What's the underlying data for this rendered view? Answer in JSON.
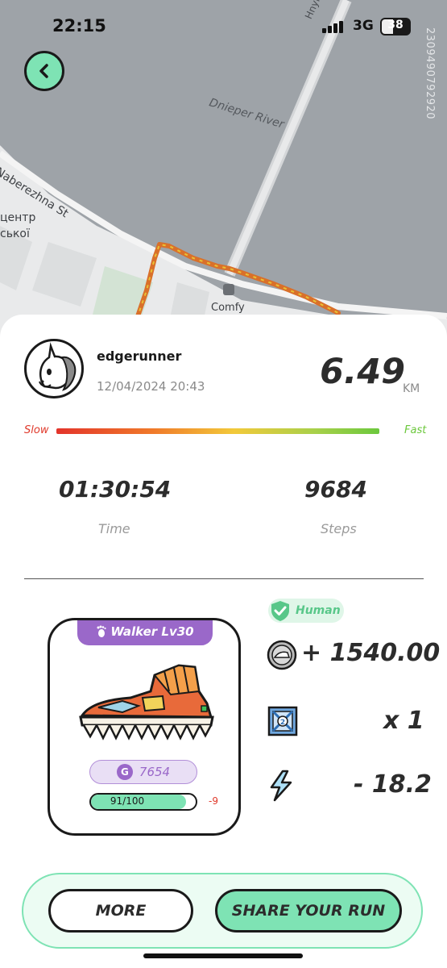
{
  "status_bar": {
    "time": "22:15",
    "network": "3G",
    "battery": "38"
  },
  "map": {
    "river_label": "Dnieper River",
    "street_label": "Naberezhna St",
    "poi_label_1": "центр",
    "poi_label_2": "ської",
    "store_label": "Comfy",
    "road_label": "Hnylyksyn",
    "watermark_id": "2309490792920"
  },
  "run": {
    "username": "edgerunner",
    "datetime": "12/04/2024 20:43",
    "distance": "6.49",
    "distance_unit": "KM",
    "pace_slow_label": "Slow",
    "pace_fast_label": "Fast",
    "time_value": "01:30:54",
    "time_label": "Time",
    "steps_value": "9684",
    "steps_label": "Steps"
  },
  "shoe": {
    "tag": "Walker Lv30",
    "gst_coin_letter": "G",
    "gst_value": "7654",
    "durability_text": "91/100",
    "durability_fraction": 0.91,
    "durability_change": "-9"
  },
  "rewards": {
    "human_label": "Human",
    "gst_earned": "+ 1540.00",
    "gem_count": "x 1",
    "energy_used": "- 18.2"
  },
  "buttons": {
    "more": "MORE",
    "share": "SHARE YOUR RUN"
  },
  "colors": {
    "accent_mint": "#7ee3b4",
    "purple": "#9a68c9",
    "slow_red": "#e0392b",
    "fast_green": "#6cc83d"
  }
}
